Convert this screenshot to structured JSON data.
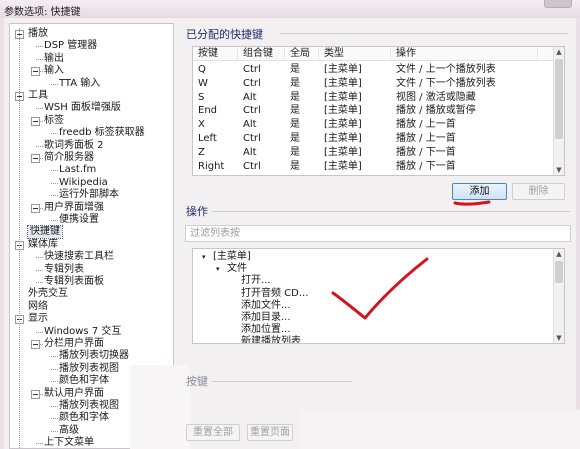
{
  "window": {
    "title": "参数选项: 快捷键"
  },
  "tree": {
    "nodes": [
      {
        "label": "播放",
        "level": 0,
        "toggle": true
      },
      {
        "label": "DSP 管理器",
        "level": 1
      },
      {
        "label": "输出",
        "level": 1
      },
      {
        "label": "输入",
        "level": 1,
        "toggle": true
      },
      {
        "label": "TTA 输入",
        "level": 2
      },
      {
        "label": "工具",
        "level": 0,
        "toggle": true
      },
      {
        "label": "WSH 面板增强版",
        "level": 1
      },
      {
        "label": "标签",
        "level": 1,
        "toggle": true
      },
      {
        "label": "freedb 标签获取器",
        "level": 2
      },
      {
        "label": "歌词秀面板 2",
        "level": 1
      },
      {
        "label": "简介服务器",
        "level": 1,
        "toggle": true
      },
      {
        "label": "Last.fm",
        "level": 2
      },
      {
        "label": "Wikipedia",
        "level": 2
      },
      {
        "label": "运行外部脚本",
        "level": 2
      },
      {
        "label": "用户界面增强",
        "level": 1,
        "toggle": true
      },
      {
        "label": "便携设置",
        "level": 2
      },
      {
        "label": "快捷键",
        "level": 0,
        "selected": true
      },
      {
        "label": "媒体库",
        "level": 0,
        "toggle": true
      },
      {
        "label": "快速搜索工具栏",
        "level": 1
      },
      {
        "label": "专辑列表",
        "level": 1
      },
      {
        "label": "专辑列表面板",
        "level": 1
      },
      {
        "label": "外壳交互",
        "level": 0
      },
      {
        "label": "网络",
        "level": 0
      },
      {
        "label": "显示",
        "level": 0,
        "toggle": true
      },
      {
        "label": "Windows 7 交互",
        "level": 1
      },
      {
        "label": "分栏用户界面",
        "level": 1,
        "toggle": true
      },
      {
        "label": "播放列表切换器",
        "level": 2
      },
      {
        "label": "播放列表视图",
        "level": 2
      },
      {
        "label": "颜色和字体",
        "level": 2
      },
      {
        "label": "默认用户界面",
        "level": 1,
        "toggle": true
      },
      {
        "label": "播放列表视图",
        "level": 2
      },
      {
        "label": "颜色和字体",
        "level": 2
      },
      {
        "label": "高级",
        "level": 2
      },
      {
        "label": "上下文菜单",
        "level": 1
      }
    ]
  },
  "assigned": {
    "title": "已分配的快捷键",
    "columns": [
      "按键",
      "组合键",
      "全局",
      "类型",
      "操作"
    ],
    "rows": [
      [
        "Q",
        "Ctrl",
        "是",
        "[主菜单]",
        "文件 / 上一个播放列表"
      ],
      [
        "W",
        "Ctrl",
        "是",
        "[主菜单]",
        "文件 / 下一个播放列表"
      ],
      [
        "S",
        "Alt",
        "是",
        "[主菜单]",
        "视图 / 激活或隐藏"
      ],
      [
        "End",
        "Ctrl",
        "是",
        "[主菜单]",
        "播放 / 播放或暂停"
      ],
      [
        "X",
        "Alt",
        "是",
        "[主菜单]",
        "播放 / 上一首"
      ],
      [
        "Left",
        "Ctrl",
        "是",
        "[主菜单]",
        "播放 / 上一首"
      ],
      [
        "Z",
        "Alt",
        "是",
        "[主菜单]",
        "播放 / 下一首"
      ],
      [
        "Right",
        "Ctrl",
        "是",
        "[主菜单]",
        "播放 / 下一首"
      ]
    ],
    "add_label": "添加",
    "remove_label": "删除"
  },
  "operation": {
    "title": "操作",
    "filter_placeholder": "过滤列表按",
    "tree": [
      {
        "label": "[主菜单]",
        "level": 0,
        "toggle": true
      },
      {
        "label": "文件",
        "level": 1,
        "toggle": true
      },
      {
        "label": "打开...",
        "level": 2
      },
      {
        "label": "打开音频 CD...",
        "level": 2
      },
      {
        "label": "添加文件...",
        "level": 2
      },
      {
        "label": "添加目录...",
        "level": 2
      },
      {
        "label": "添加位置...",
        "level": 2
      },
      {
        "label": "新建播放列表",
        "level": 2
      }
    ]
  },
  "keys_section": {
    "title": "按键",
    "reset_all_label": "重置全部",
    "reset_page_label": "重置页面"
  },
  "colors": {
    "annotation_red": "#d4141c",
    "selection": "#e8e8f4"
  }
}
